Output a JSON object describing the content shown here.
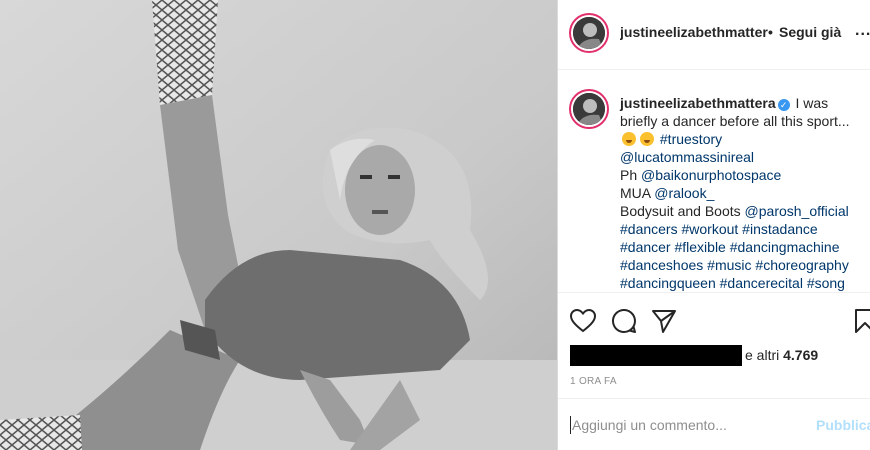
{
  "post": {
    "image_alt": "Black and white photo of a blonde woman in a leotard lying on the floor with one leg raised, wearing snakeskin boots"
  },
  "header": {
    "username": "justineelizabethmattera",
    "separator": "•",
    "follow_label": "Segui già",
    "more_label": "..."
  },
  "caption": {
    "username": "justineelizabethmattera",
    "verified_mark": "✓",
    "text_intro": "I was briefly a dancer before all this sport...",
    "hashtag_truestory": "#truestory",
    "mention_photographer": "@lucatommassinireal",
    "ph_label": "Ph",
    "mention_photospace": "@baikonurphotospace",
    "mua_label": "MUA",
    "mention_mua": "@ralook_",
    "bodysuit_label": "Bodysuit and Boots",
    "mention_bodysuit": "@parosh_official",
    "hashtags_line1": "#dancers #workout #instadance",
    "hashtags_line2": "#dancer #flexible #dancingmachine",
    "hashtags_line3": "#danceshoes #music #choreography",
    "hashtags_line4": "#dancingqueen #dancerecital #song"
  },
  "actions": {
    "likes_suffix": "e altri",
    "likes_count": "4.769",
    "timestamp": "1 ORA FA"
  },
  "comment": {
    "placeholder": "Aggiungi un commento...",
    "publish_label": "Pubblica"
  },
  "colors": {
    "verified": "#3897f0",
    "link": "#00376b",
    "publish_disabled": "#b2dffc",
    "story_ring": "#e1306c"
  }
}
